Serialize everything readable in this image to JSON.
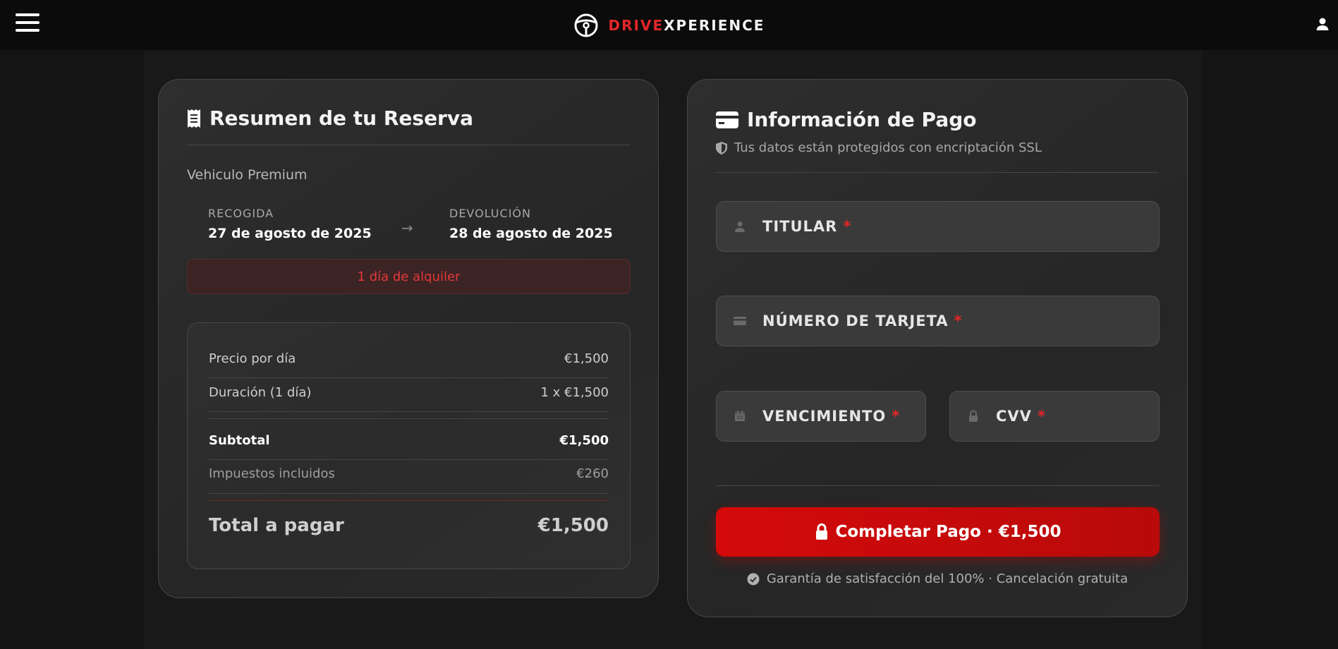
{
  "header": {
    "brand_part1": "DRIVE",
    "brand_part2": "XPERIENCE",
    "menu_icon": "hamburger-icon",
    "logo_icon": "steering-wheel-icon",
    "user_icon": "user-icon"
  },
  "summary": {
    "title": "Resumen de tu Reserva",
    "title_icon": "receipt-icon",
    "vehicle": "Vehiculo Premium",
    "pickup_label": "RECOGIDA",
    "pickup_date": "27 de agosto de 2025",
    "return_label": "DEVOLUCIÓN",
    "return_date": "28 de agosto de 2025",
    "arrow": "→",
    "rental_days": "1 día de alquiler",
    "prices": {
      "price_per_day_label": "Precio por día",
      "price_per_day_value": "€1,500",
      "duration_label": "Duración (1 día)",
      "duration_value": "1 x €1,500",
      "subtotal_label": "Subtotal",
      "subtotal_value": "€1,500",
      "taxes_label": "Impuestos incluidos",
      "taxes_value": "€260",
      "total_label": "Total a pagar",
      "total_value": "€1,500"
    }
  },
  "payment": {
    "title": "Información de Pago",
    "title_icon": "credit-card-icon",
    "ssl_icon": "shield-icon",
    "ssl_note": "Tus datos están protegidos con encriptación SSL",
    "fields": {
      "holder_label": "TITULAR",
      "card_number_label": "NÚMERO DE TARJETA",
      "expiry_label": "VENCIMIENTO",
      "cvv_label": "CVV",
      "required_mark": "*"
    },
    "button_label": "Completar Pago · €1,500",
    "button_icon": "lock-icon",
    "guarantee_icon": "check-circle-icon",
    "guarantee": "Garantía de satisfacción del 100% · Cancelación gratuita"
  },
  "colors": {
    "accent": "#e3262a",
    "button": "#d40a0a",
    "background": "#141414",
    "card": "#2b2b2b"
  }
}
